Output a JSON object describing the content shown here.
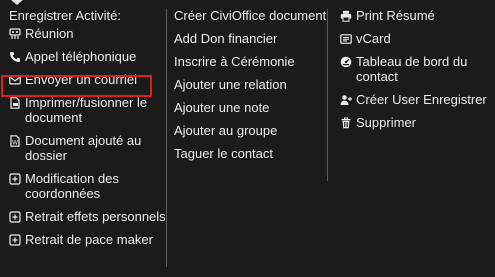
{
  "menu": {
    "col1": {
      "heading": "Enregistrer Activité:",
      "items": [
        {
          "label": "Réunion",
          "icon": "meeting-icon"
        },
        {
          "label": "Appel téléphonique",
          "icon": "phone-icon"
        },
        {
          "label": "Envoyer un courriel",
          "icon": "envelope-icon"
        },
        {
          "label": "Imprimer/fusionner le document",
          "icon": "print-document-icon"
        },
        {
          "label": "Document ajouté au dossier",
          "icon": "document-icon"
        },
        {
          "label": "Modification des coordonnées",
          "icon": "plus-square-icon"
        },
        {
          "label": "Retrait effets personnels",
          "icon": "plus-square-icon"
        },
        {
          "label": "Retrait de pace maker",
          "icon": "plus-square-icon"
        }
      ]
    },
    "col2": {
      "items": [
        {
          "label": "Créer CiviOffice document"
        },
        {
          "label": "Add Don financier"
        },
        {
          "label": "Inscrire à Cérémonie"
        },
        {
          "label": "Ajouter une relation"
        },
        {
          "label": "Ajouter une note"
        },
        {
          "label": "Ajouter au groupe"
        },
        {
          "label": "Taguer le contact"
        }
      ]
    },
    "col3": {
      "items": [
        {
          "label": "Print Résumé",
          "icon": "printer-icon"
        },
        {
          "label": "vCard",
          "icon": "vcard-icon"
        },
        {
          "label": "Tableau de bord du contact",
          "icon": "dashboard-icon"
        },
        {
          "label": "Créer User Enregistrer",
          "icon": "user-plus-icon"
        },
        {
          "label": "Supprimer",
          "icon": "trash-icon"
        }
      ]
    }
  },
  "colors": {
    "background": "#1b1b1b",
    "text": "#ececec",
    "separator": "#5a5a5a",
    "highlight": "#e01c1c"
  }
}
